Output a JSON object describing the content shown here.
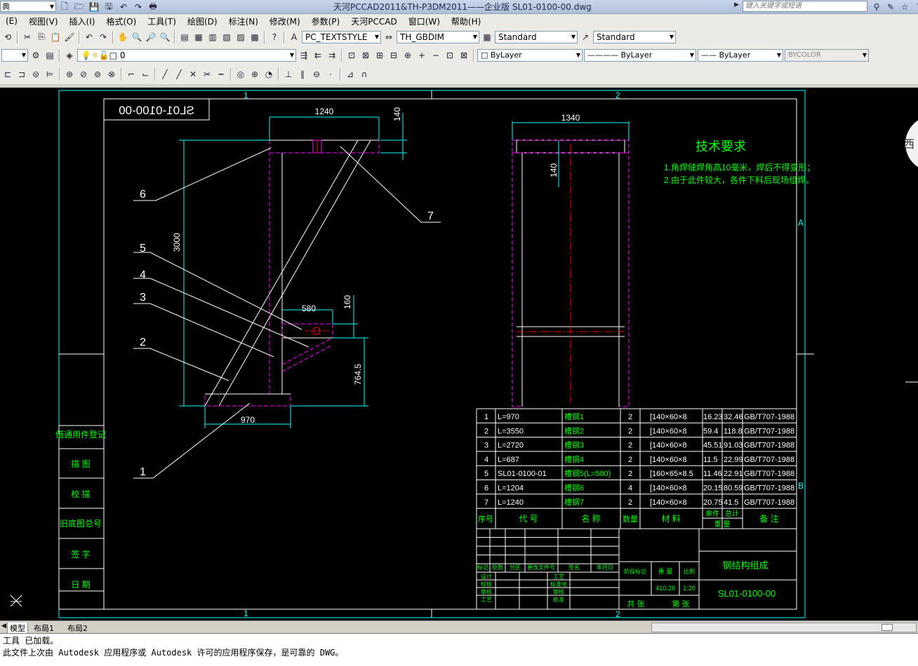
{
  "titlebar": {
    "title": "天河PCCAD2011&TH-P3DM2011——企业版    SL01-0100-00.dwg",
    "workspace_value": "典",
    "search_placeholder": "键入关键字或短语"
  },
  "menu": [
    "(E)",
    "视图(V)",
    "插入(I)",
    "格式(O)",
    "工具(T)",
    "绘图(D)",
    "标注(N)",
    "修改(M)",
    "参数(P)",
    "天河PCCAD",
    "窗口(W)",
    "帮助(H)"
  ],
  "toolbar2": {
    "text_style": "PC_TEXTSTYLE",
    "dim_style": "TH_GBDIM",
    "table_style": "Standard",
    "multileader_style": "Standard"
  },
  "toolbar3": {
    "layer_value": "0",
    "color": "ByLayer",
    "linetype": "ByLayer",
    "lineweight": "ByLayer",
    "plotstyle": "BYCOLOR"
  },
  "drawing": {
    "title_stamp": "SL01-0100-00",
    "zone_top": [
      "1",
      "2"
    ],
    "zone_right": [
      "A",
      "B"
    ],
    "right_edge_char": "西",
    "dims": {
      "top_width": "1240",
      "top_height": "140",
      "total_height": "3000",
      "bracket_width": "580",
      "bracket_height": "160",
      "bracket_elev": "764.5",
      "base_width": "970",
      "side_width": "1340",
      "side_height": "140"
    },
    "balloons": [
      "6",
      "5",
      "4",
      "3",
      "2",
      "1",
      "7"
    ],
    "tech": {
      "title": "技术要求",
      "line1": "1.角焊缝焊角高10毫米，焊后不得变形；",
      "line2": "2.由于此件较大，各件下料后现场组焊。"
    },
    "side_labels": [
      "借通用件登记",
      "描 图",
      "校 描",
      "旧底图总号",
      "签 字",
      "日 期"
    ],
    "bom_rows": [
      {
        "no": "7",
        "code": "L=1240",
        "name": "槽钢7",
        "qty": "2",
        "mat": "[140×60×8",
        "w1": "20.75",
        "w2": "41.5",
        "note": "GB/T707-1988"
      },
      {
        "no": "6",
        "code": "L=1204",
        "name": "槽钢6",
        "qty": "4",
        "mat": "[140×60×8",
        "w1": "20.15",
        "w2": "80.59",
        "note": "GB/T707-1988"
      },
      {
        "no": "5",
        "code": "SL01-0100-01",
        "name": "槽钢5(L=580)",
        "qty": "2",
        "mat": "[160×65×8.5",
        "w1": "11.46",
        "w2": "22.91",
        "note": "GB/T707-1988"
      },
      {
        "no": "4",
        "code": "L=687",
        "name": "槽钢4",
        "qty": "2",
        "mat": "[140×60×8",
        "w1": "11.5",
        "w2": "22.99",
        "note": "GB/T707-1988"
      },
      {
        "no": "3",
        "code": "L=2720",
        "name": "槽钢3",
        "qty": "2",
        "mat": "[140×60×8",
        "w1": "45.51",
        "w2": "91.03",
        "note": "GB/T707-1988"
      },
      {
        "no": "2",
        "code": "L=3550",
        "name": "槽钢2",
        "qty": "2",
        "mat": "[140×60×8",
        "w1": "59.4",
        "w2": "118.8",
        "note": "GB/T707-1988"
      },
      {
        "no": "1",
        "code": "L=970",
        "name": "槽钢1",
        "qty": "2",
        "mat": "[140×60×8",
        "w1": "16.23",
        "w2": "32.46",
        "note": "GB/T707-1988"
      }
    ],
    "bom_header": {
      "no": "序号",
      "code": "代 号",
      "name": "名 称",
      "qty": "数量",
      "mat": "材 料",
      "w1": "单件",
      "w2": "总计",
      "weight": "重 量",
      "note": "备 注"
    },
    "title_block": {
      "part_name": "钢结构组成",
      "drawing_no": "SL01-0100-00",
      "stage_label": "阶段标记",
      "weight_label": "重 量",
      "scale_label": "比例",
      "weight": "410.28",
      "scale": "1:20",
      "total_label": "共 张",
      "sheet_label": "第 张",
      "rev_cols": [
        "标记",
        "处数",
        "分区",
        "更改文件号",
        "签名",
        "年月日"
      ],
      "roles": [
        "设计",
        "校核",
        "审核",
        "工艺"
      ],
      "roles2": [
        "工艺",
        "标准化",
        "审核",
        "批准"
      ]
    }
  },
  "tabs": [
    "模型",
    "布局1",
    "布局2"
  ],
  "command": {
    "line1": "工具 已加载。",
    "line2": "此文件上次由 Autodesk 应用程序或 Autodesk 许可的应用程序保存，是可靠的 DWG。"
  }
}
